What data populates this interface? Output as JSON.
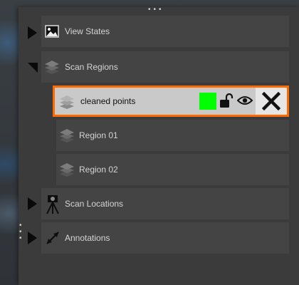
{
  "tree": {
    "items": [
      {
        "label": "View States",
        "icon": "image-icon",
        "expanded": false
      },
      {
        "label": "Scan Regions",
        "icon": "layers-icon",
        "expanded": true,
        "children": [
          {
            "label": "cleaned points",
            "icon": "layers-icon",
            "selected": true,
            "color": "#00ff00"
          },
          {
            "label": "Region 01",
            "icon": "layers-icon"
          },
          {
            "label": "Region 02",
            "icon": "layers-icon"
          }
        ]
      },
      {
        "label": "Scan Locations",
        "icon": "tripod-scanner-icon",
        "expanded": false
      },
      {
        "label": "Annotations",
        "icon": "diagonal-arrow-icon",
        "expanded": false
      }
    ]
  },
  "colors": {
    "selection_border": "#ff6a00",
    "swatch": "#00ff00"
  }
}
